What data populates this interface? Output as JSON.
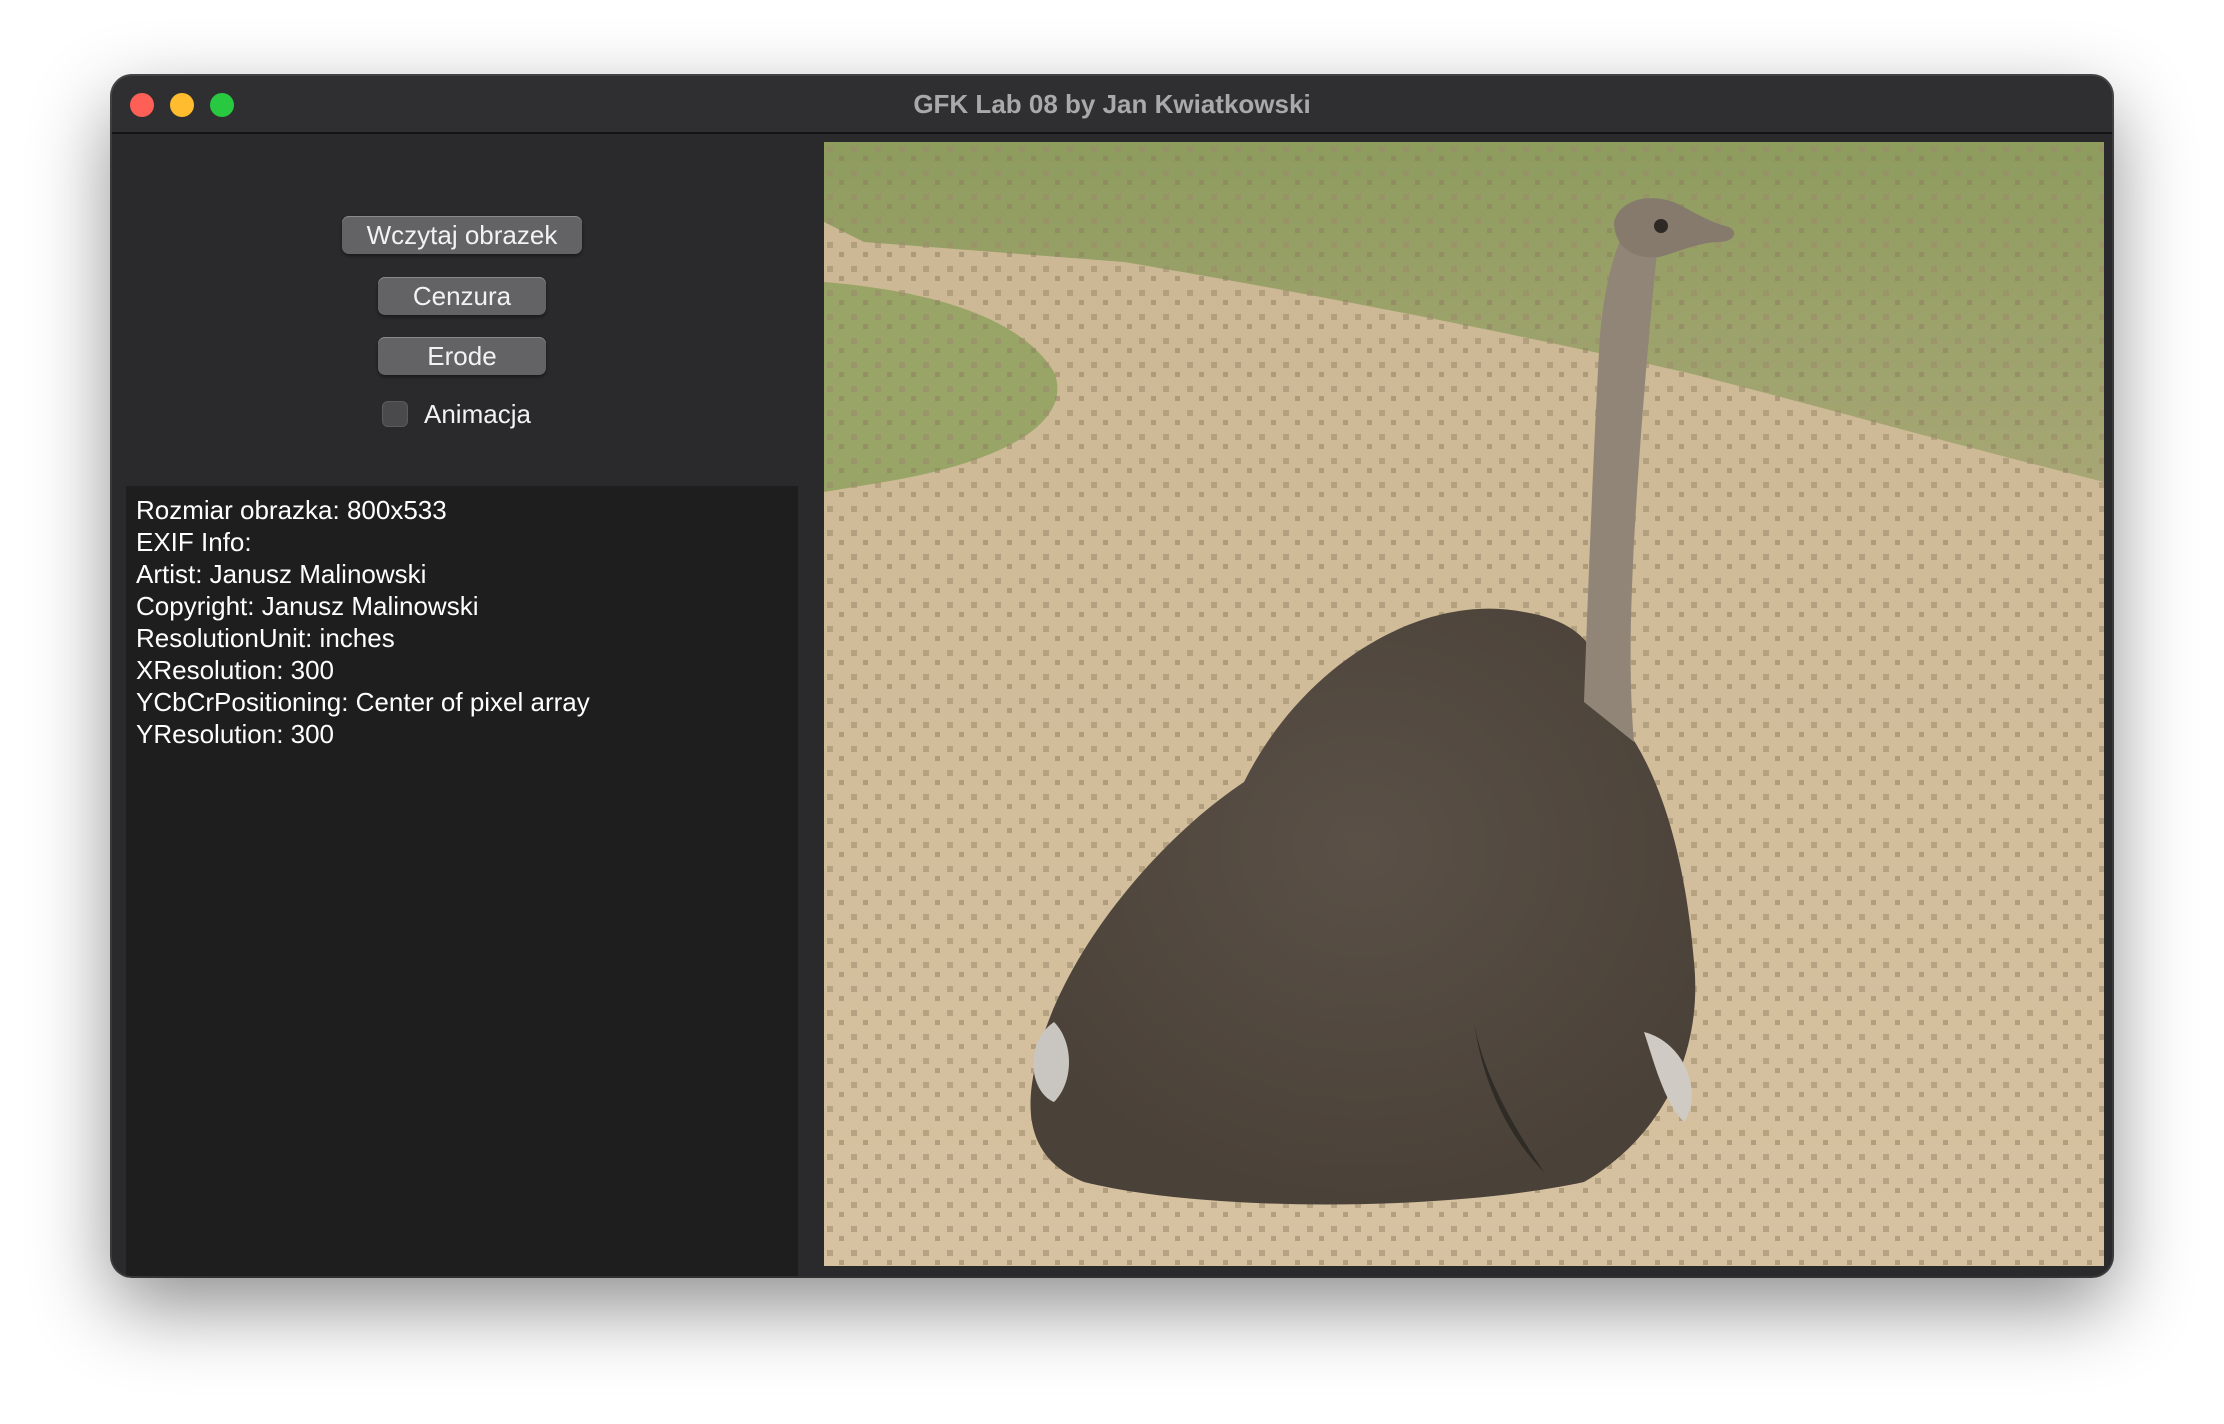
{
  "window": {
    "title": "GFK Lab 08 by Jan Kwiatkowski"
  },
  "controls": {
    "load_button": "Wczytaj obrazek",
    "censor_button": "Cenzura",
    "erode_button": "Erode",
    "animation_checkbox": {
      "label": "Animacja",
      "checked": false
    }
  },
  "info": {
    "lines": [
      "Rozmiar obrazka: 800x533",
      "EXIF Info:",
      "Artist: Janusz Malinowski",
      "Copyright: Janusz Malinowski",
      "ResolutionUnit: inches",
      "XResolution: 300",
      "YCbCrPositioning: Center of pixel array",
      "YResolution: 300"
    ]
  },
  "colors": {
    "close": "#fe5f57",
    "minimize": "#febc2e",
    "maximize": "#28c840",
    "sand": "#c9b491",
    "grass": "#8f9f5a",
    "ostrich_body": "#5f554a"
  }
}
